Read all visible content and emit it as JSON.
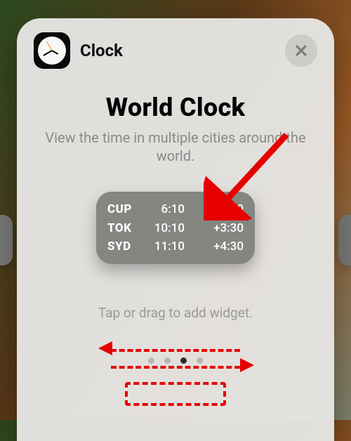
{
  "header": {
    "app_name": "Clock",
    "app_icon": "clock-icon",
    "close_icon": "close-icon"
  },
  "title": "World Clock",
  "subtitle": "View the time in multiple cities around the world.",
  "widget": {
    "rows": [
      {
        "city": "CUP",
        "time": "6:10",
        "offset": "-12:30"
      },
      {
        "city": "TOK",
        "time": "10:10",
        "offset": "+3:30"
      },
      {
        "city": "SYD",
        "time": "11:10",
        "offset": "+4:30"
      }
    ]
  },
  "hint": "Tap or drag to add widget.",
  "pager": {
    "count": 4,
    "active_index": 2
  },
  "colors": {
    "annotation": "#e60000",
    "widget_bg": "#838681"
  }
}
